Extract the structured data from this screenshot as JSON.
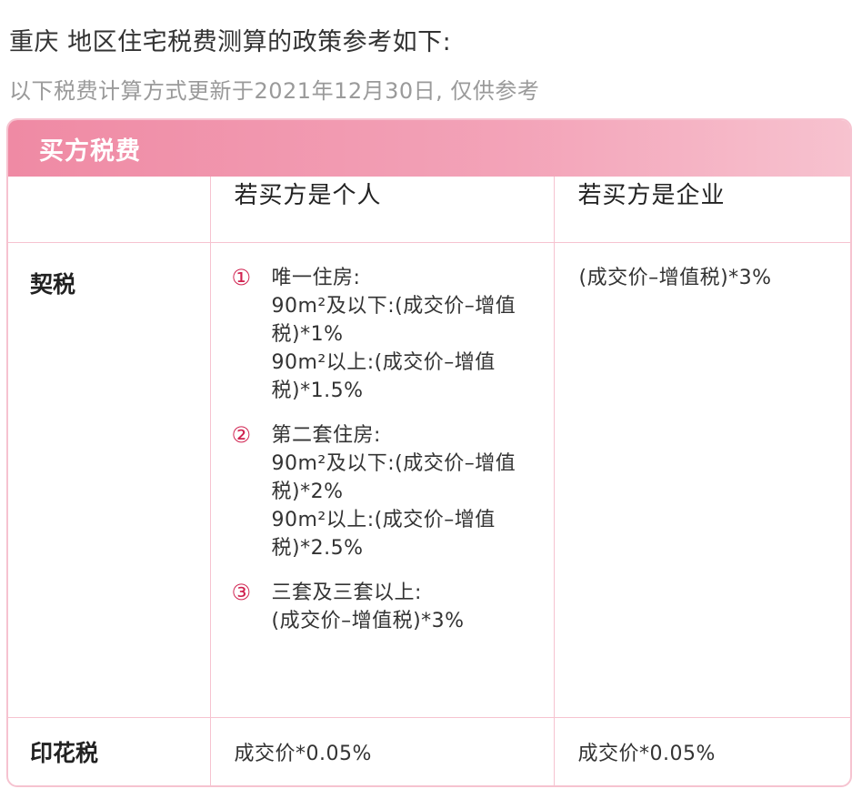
{
  "heading": "重庆 地区住宅税费测算的政策参考如下:",
  "subheading": "以下税费计算方式更新于2021年12月30日, 仅供参考",
  "card": {
    "title": "买方税费",
    "columns": [
      "",
      "若买方是个人",
      "若买方是企业"
    ],
    "rows": {
      "qishui": {
        "label": "契税",
        "person_items": [
          {
            "num": "①",
            "lines": [
              "唯一住房:",
              "90m²及以下:(成交价–增值税)*1%",
              "90m²以上:(成交价–增值税)*1.5%"
            ]
          },
          {
            "num": "②",
            "lines": [
              "第二套住房:",
              "90m²及以下:(成交价–增值税)*2%",
              "90m²以上:(成交价–增值税)*2.5%"
            ]
          },
          {
            "num": "③",
            "lines": [
              "三套及三套以上:",
              "(成交价–增值税)*3%"
            ]
          }
        ],
        "company": "(成交价–增值税)*3%"
      },
      "yinhua": {
        "label": "印花税",
        "person": "成交价*0.05%",
        "company": "成交价*0.05%"
      }
    }
  }
}
